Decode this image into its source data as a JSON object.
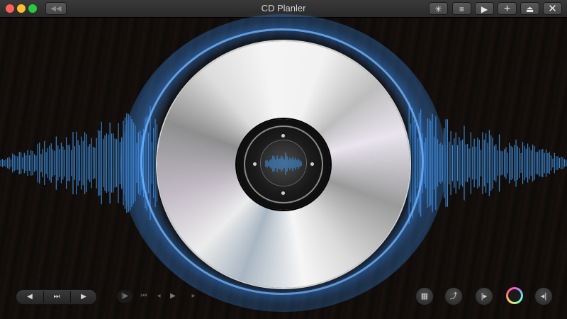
{
  "window": {
    "title": "CD Planler",
    "back_icon": "rewind-icon",
    "toolbar": [
      {
        "name": "tools-button",
        "icon": "sparkle-icon",
        "glyph": "✳"
      },
      {
        "name": "menu-button",
        "icon": "menu-lines-icon",
        "glyph": "≡"
      },
      {
        "name": "play-button",
        "icon": "play-icon",
        "glyph": "▶"
      },
      {
        "name": "add-button",
        "icon": "plus-icon",
        "glyph": "+"
      },
      {
        "name": "eject-button",
        "icon": "eject-icon",
        "glyph": "⏏"
      },
      {
        "name": "close-button",
        "icon": "close-icon",
        "glyph": "✕"
      }
    ]
  },
  "colors": {
    "accent_blue": "#4a9be8",
    "wave_blue": "#3d8fe0",
    "background": "#0b0a09"
  },
  "transport": {
    "prev": "◀",
    "skip": "⏭",
    "next": "▶"
  },
  "mini_transport": {
    "step": "|▶",
    "first": "⏮",
    "back": "◂",
    "play": "▶",
    "forward": "▸"
  },
  "right_controls": {
    "grid": "▦",
    "repeat": "⤴",
    "play_step": "|▸",
    "volume": "◂|"
  }
}
